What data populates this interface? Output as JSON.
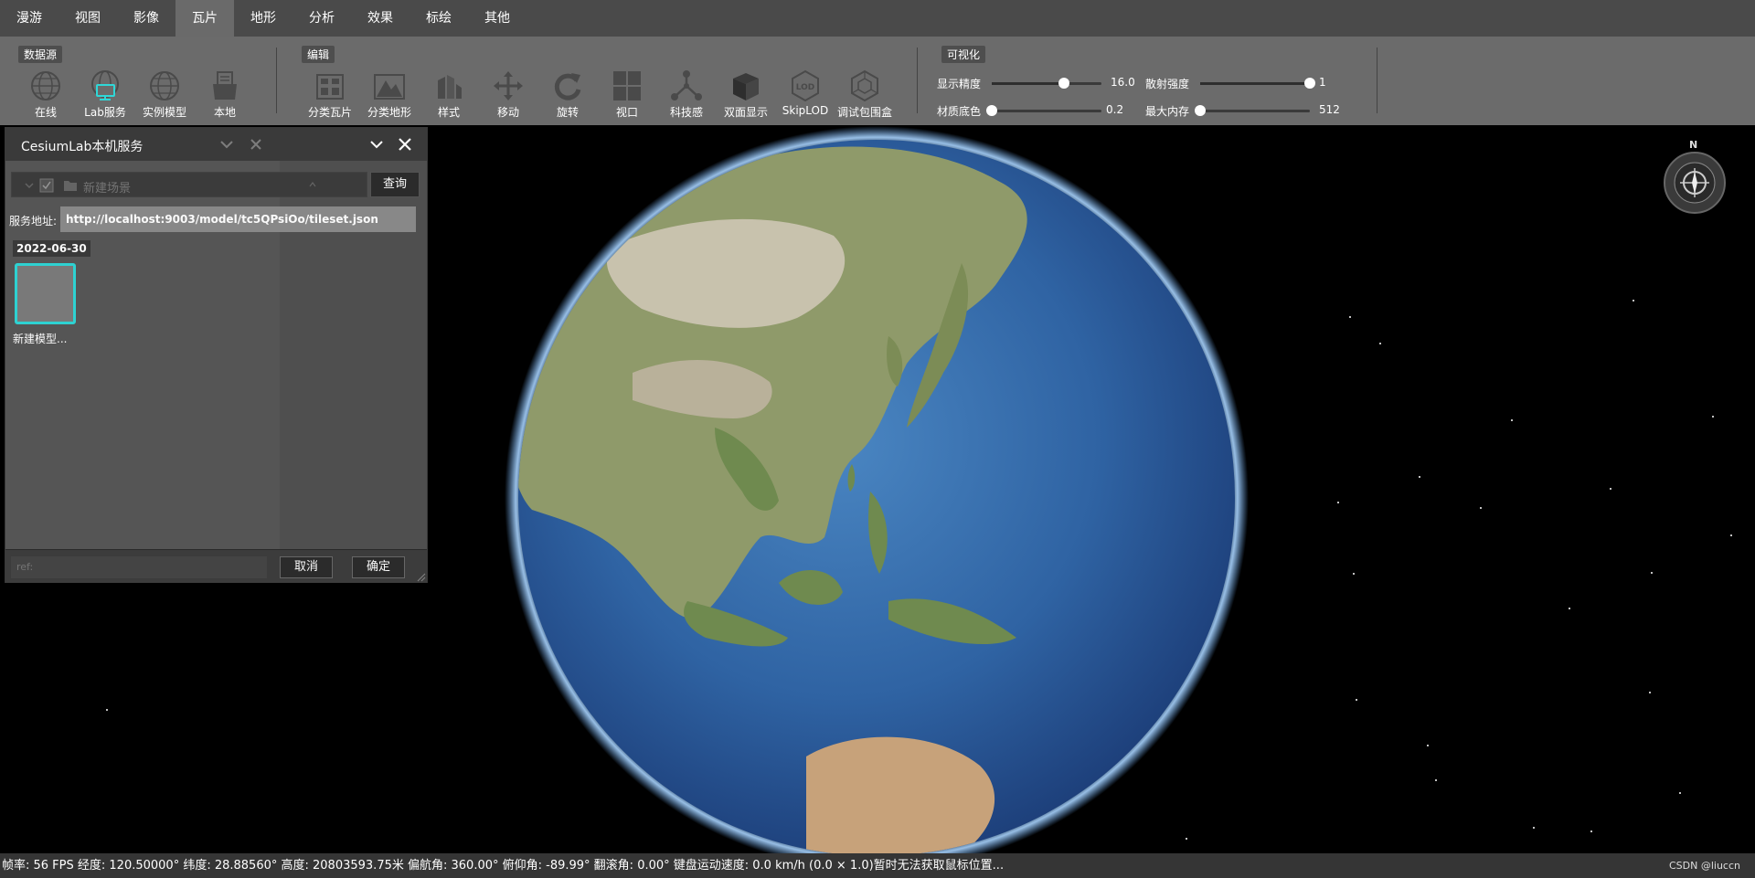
{
  "menu": {
    "items": [
      {
        "label": "漫游",
        "active": false
      },
      {
        "label": "视图",
        "active": false
      },
      {
        "label": "影像",
        "active": false
      },
      {
        "label": "瓦片",
        "active": true
      },
      {
        "label": "地形",
        "active": false
      },
      {
        "label": "分析",
        "active": false
      },
      {
        "label": "效果",
        "active": false
      },
      {
        "label": "标绘",
        "active": false
      },
      {
        "label": "其他",
        "active": false
      }
    ]
  },
  "ribbon": {
    "datasource": {
      "title": "数据源",
      "tools": [
        {
          "label": "在线",
          "icon": "globe-online-icon"
        },
        {
          "label": "Lab服务",
          "icon": "lab-service-icon"
        },
        {
          "label": "实例模型",
          "icon": "instance-model-icon"
        },
        {
          "label": "本地",
          "icon": "local-folder-icon"
        }
      ]
    },
    "edit": {
      "title": "编辑",
      "tools": [
        {
          "label": "分类瓦片",
          "icon": "classify-tile-icon"
        },
        {
          "label": "分类地形",
          "icon": "classify-terrain-icon"
        },
        {
          "label": "样式",
          "icon": "style-icon"
        },
        {
          "label": "移动",
          "icon": "move-icon"
        },
        {
          "label": "旋转",
          "icon": "rotate-icon"
        },
        {
          "label": "视口",
          "icon": "viewport-icon"
        },
        {
          "label": "科技感",
          "icon": "tech-icon"
        },
        {
          "label": "双面显示",
          "icon": "double-side-icon"
        },
        {
          "label": "SkipLOD",
          "icon": "skiplod-icon"
        },
        {
          "label": "调试包围盒",
          "icon": "debug-bbox-icon"
        }
      ]
    },
    "visualize": {
      "title": "可视化",
      "sliders": [
        {
          "label": "显示精度",
          "value": "16.0",
          "fraction": 0.66
        },
        {
          "label": "散射强度",
          "value": "1",
          "fraction": 1.0
        },
        {
          "label": "材质底色",
          "value": "0.2",
          "fraction": 0.0
        },
        {
          "label": "最大内存",
          "value": "512",
          "fraction": 0.0
        }
      ]
    }
  },
  "dialog": {
    "title": "CesiumLab本机服务",
    "scene_placeholder": "新建场景",
    "query_label": "查询",
    "url_label": "服务地址:",
    "url_value": "http://localhost:9003/model/tc5QPsiOo/tileset.json",
    "date": "2022-06-30",
    "model_label": "新建模型...",
    "ref_placeholder": "ref:",
    "cancel_label": "取消",
    "ok_label": "确定",
    "accent": "#2fd7d7"
  },
  "compass": {
    "north": "N"
  },
  "status": {
    "text": "帧率: 56 FPS 经度: 120.50000° 纬度: 28.88560° 高度: 20803593.75米 偏航角: 360.00° 俯仰角: -89.99° 翻滚角: 0.00° 键盘运动速度: 0.0 km/h (0.0 × 1.0)暂时无法获取鼠标位置..."
  },
  "watermark": "CSDN @liuccn"
}
